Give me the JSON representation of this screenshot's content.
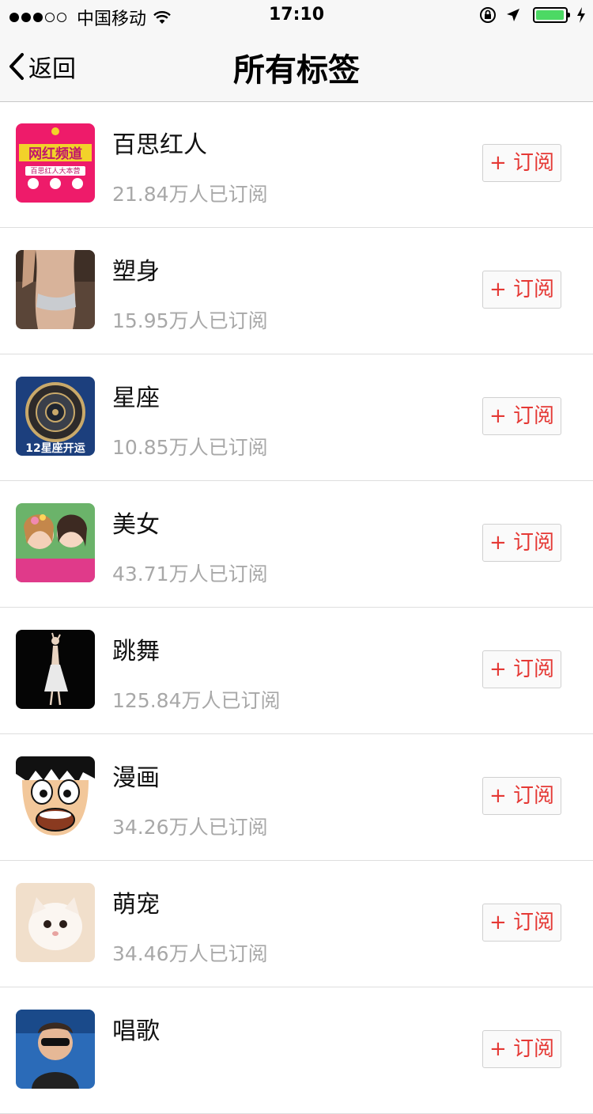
{
  "status_bar": {
    "carrier": "中国移动",
    "time": "17:10",
    "battery_color": "#4cd964"
  },
  "nav": {
    "back_label": "返回",
    "title": "所有标签"
  },
  "accent_color": "#e53935",
  "tags": [
    {
      "name": "百思红人",
      "subscribers": "21.84万人已订阅",
      "button": "+ 订阅",
      "icon": "wanghong-channel-icon"
    },
    {
      "name": "塑身",
      "subscribers": "15.95万人已订阅",
      "button": "+ 订阅",
      "icon": "body-shaping-photo"
    },
    {
      "name": "星座",
      "subscribers": "10.85万人已订阅",
      "button": "+ 订阅",
      "icon": "zodiac-wheel-icon"
    },
    {
      "name": "美女",
      "subscribers": "43.71万人已订阅",
      "button": "+ 订阅",
      "icon": "beauty-photo"
    },
    {
      "name": "跳舞",
      "subscribers": "125.84万人已订阅",
      "button": "+ 订阅",
      "icon": "dancer-photo"
    },
    {
      "name": "漫画",
      "subscribers": "34.26万人已订阅",
      "button": "+ 订阅",
      "icon": "cartoon-face-icon"
    },
    {
      "name": "萌宠",
      "subscribers": "34.46万人已订阅",
      "button": "+ 订阅",
      "icon": "kitten-photo"
    },
    {
      "name": "唱歌",
      "subscribers": "",
      "button": "+ 订阅",
      "icon": "singer-photo"
    }
  ],
  "thumb_captions": {
    "wanghong_logo": "网红频道",
    "wanghong_sub": "百思红人大本营",
    "zodiac_caption": "12星座开运"
  }
}
